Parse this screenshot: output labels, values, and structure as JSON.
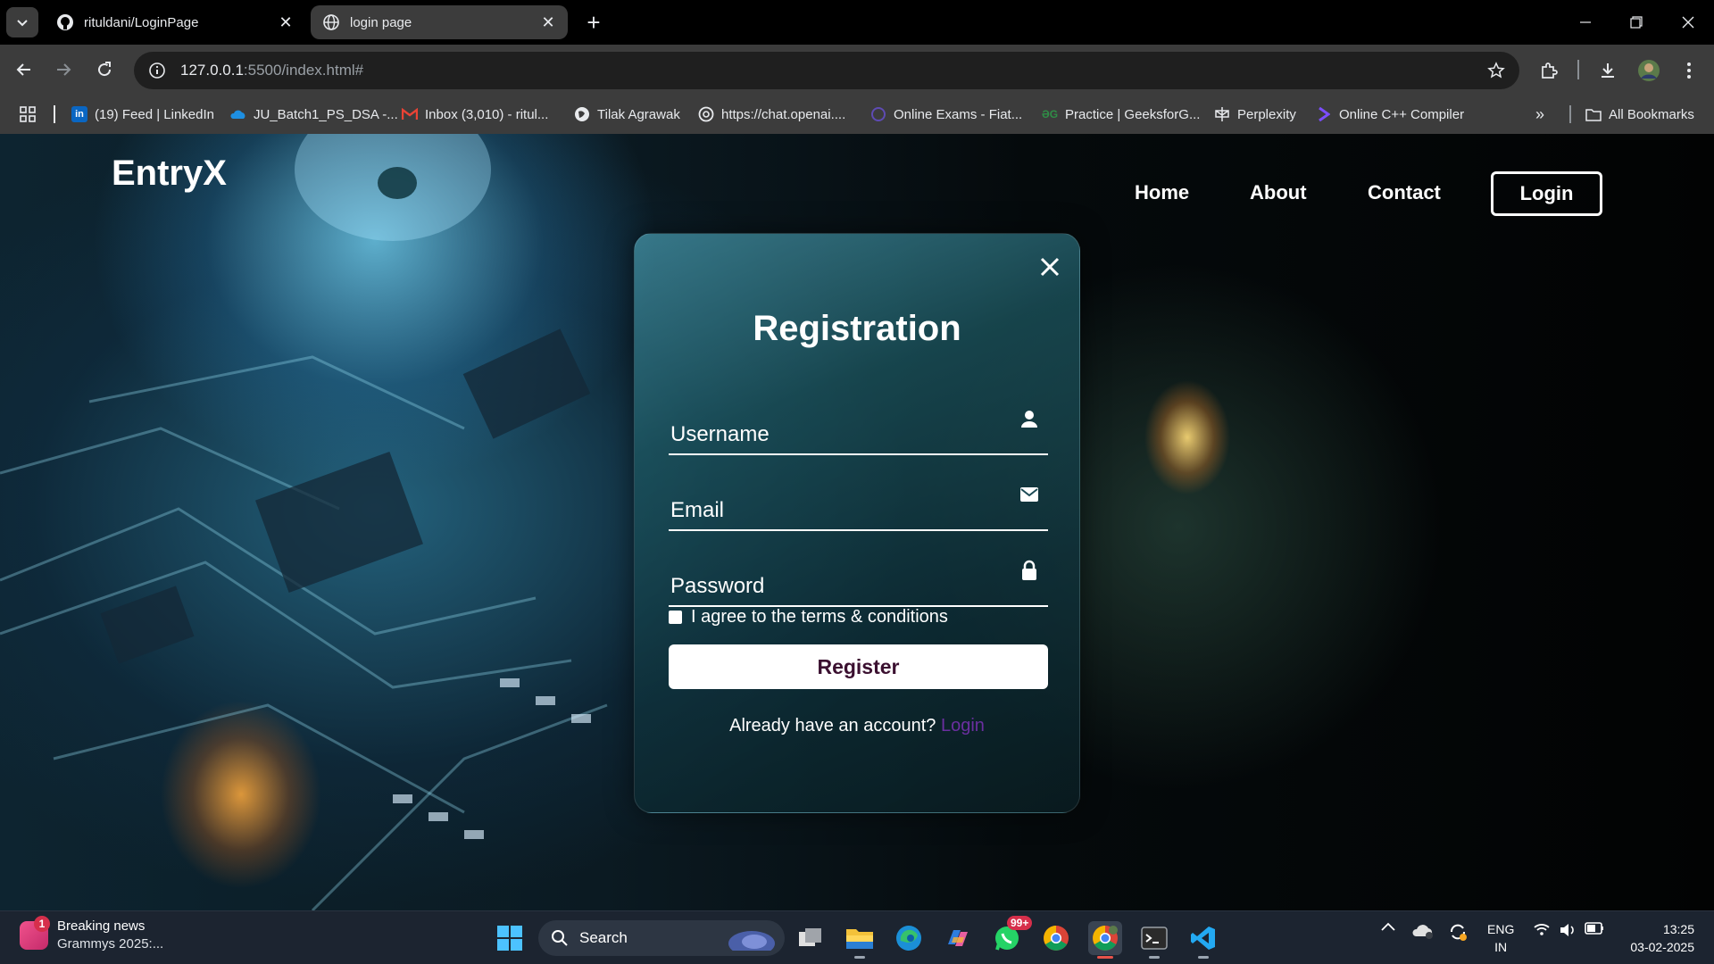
{
  "browser": {
    "tabs": [
      {
        "title": "rituldani/LoginPage",
        "favicon": "github-icon"
      },
      {
        "title": "login page",
        "favicon": "globe-icon"
      }
    ],
    "url_host": "127.0.0.1",
    "url_rest": ":5500/index.html#",
    "bookmarks": [
      {
        "label": "(19) Feed | LinkedIn",
        "icon": "linkedin-icon"
      },
      {
        "label": "JU_Batch1_PS_DSA -...",
        "icon": "onedrive-icon"
      },
      {
        "label": "Inbox (3,010) - ritul...",
        "icon": "gmail-icon"
      },
      {
        "label": "Tilak Agrawak",
        "icon": "globe-icon"
      },
      {
        "label": "https://chat.openai....",
        "icon": "openai-icon"
      },
      {
        "label": "Online Exams - Fiat...",
        "icon": "exam-icon"
      },
      {
        "label": "Practice | GeeksforG...",
        "icon": "gfg-icon"
      },
      {
        "label": "Perplexity",
        "icon": "perplexity-icon"
      },
      {
        "label": "Online C++ Compiler",
        "icon": "compiler-icon"
      }
    ],
    "all_bookmarks": "All Bookmarks"
  },
  "site": {
    "logo": "EntryX",
    "nav": {
      "home": "Home",
      "about": "About",
      "contact": "Contact",
      "login": "Login"
    }
  },
  "form": {
    "title": "Registration",
    "username_placeholder": "Username",
    "email_placeholder": "Email",
    "password_placeholder": "Password",
    "terms": "I agree to the terms & conditions",
    "register": "Register",
    "switch_text": "Already have an account?",
    "switch_link": "Login"
  },
  "taskbar": {
    "news_badge": "1",
    "news_title": "Breaking news",
    "news_sub": "Grammys 2025:...",
    "search": "Search",
    "whatsapp_badge": "99+",
    "lang1": "ENG",
    "lang2": "IN",
    "time": "13:25",
    "date": "03-02-2025"
  },
  "colors": {
    "chrome_bg": "#000000",
    "toolbar_bg": "#3c3c3c",
    "link_purple": "#6b2fa0",
    "taskbar_bg": "#1c2430"
  }
}
